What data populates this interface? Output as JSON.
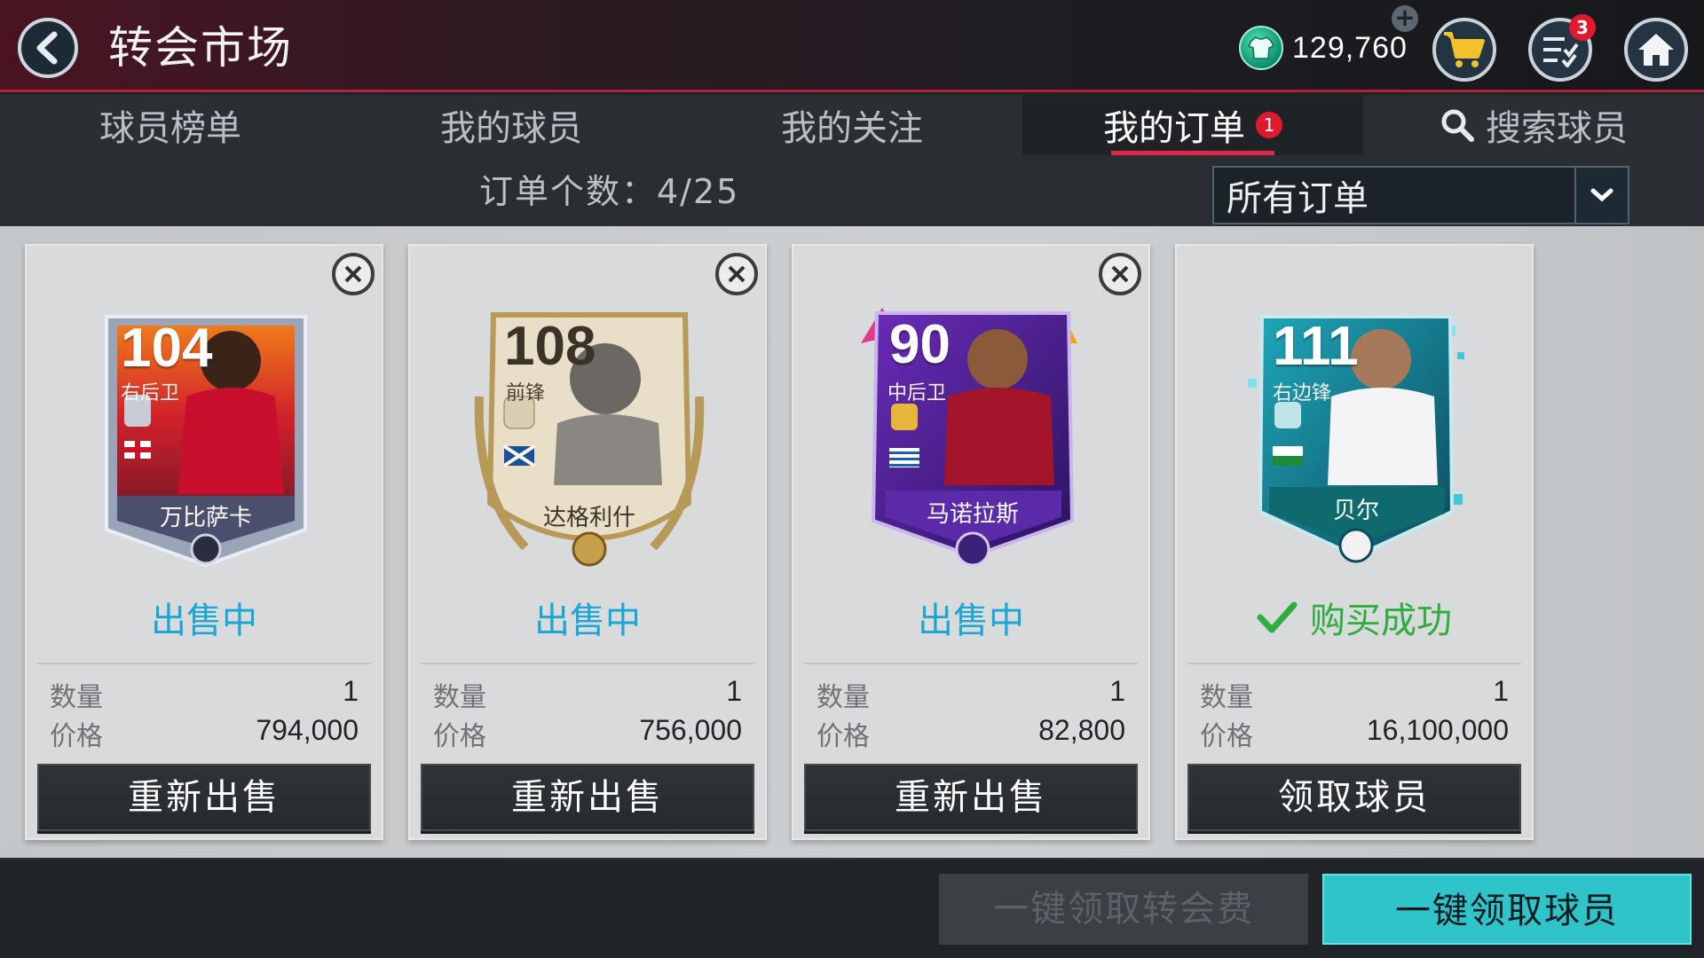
{
  "header": {
    "title": "转会市场",
    "currency_value": "129,760",
    "menu_badge": "3"
  },
  "tabs": [
    {
      "label": "球员榜单"
    },
    {
      "label": "我的球员"
    },
    {
      "label": "我的关注"
    },
    {
      "label": "我的订单",
      "badge": "1",
      "active": true
    },
    {
      "label": "搜索球员"
    }
  ],
  "filter": {
    "order_count": "订单个数：4/25",
    "dropdown_selected": "所有订单"
  },
  "cards": [
    {
      "rating": "104",
      "position": "右后卫",
      "player": "万比萨卡",
      "status": "出售中",
      "qty_label": "数量",
      "qty": "1",
      "price_label": "价格",
      "price": "794,000",
      "button": "重新出售"
    },
    {
      "rating": "108",
      "position": "前锋",
      "player": "达格利什",
      "status": "出售中",
      "qty_label": "数量",
      "qty": "1",
      "price_label": "价格",
      "price": "756,000",
      "button": "重新出售"
    },
    {
      "rating": "90",
      "position": "中后卫",
      "player": "马诺拉斯",
      "status": "出售中",
      "qty_label": "数量",
      "qty": "1",
      "price_label": "价格",
      "price": "82,800",
      "button": "重新出售"
    },
    {
      "rating": "111",
      "position": "右边锋",
      "player": "贝尔",
      "status": "购买成功",
      "qty_label": "数量",
      "qty": "1",
      "price_label": "价格",
      "price": "16,100,000",
      "button": "领取球员"
    }
  ],
  "bottom": {
    "claim_fee_label": "一键领取转会费",
    "claim_players_label": "一键领取球员"
  },
  "colors": {
    "accent_red": "#e0284a",
    "selling_blue": "#1aa7d6",
    "success_green": "#2eae3f",
    "primary_cyan": "#2ec4c9"
  }
}
